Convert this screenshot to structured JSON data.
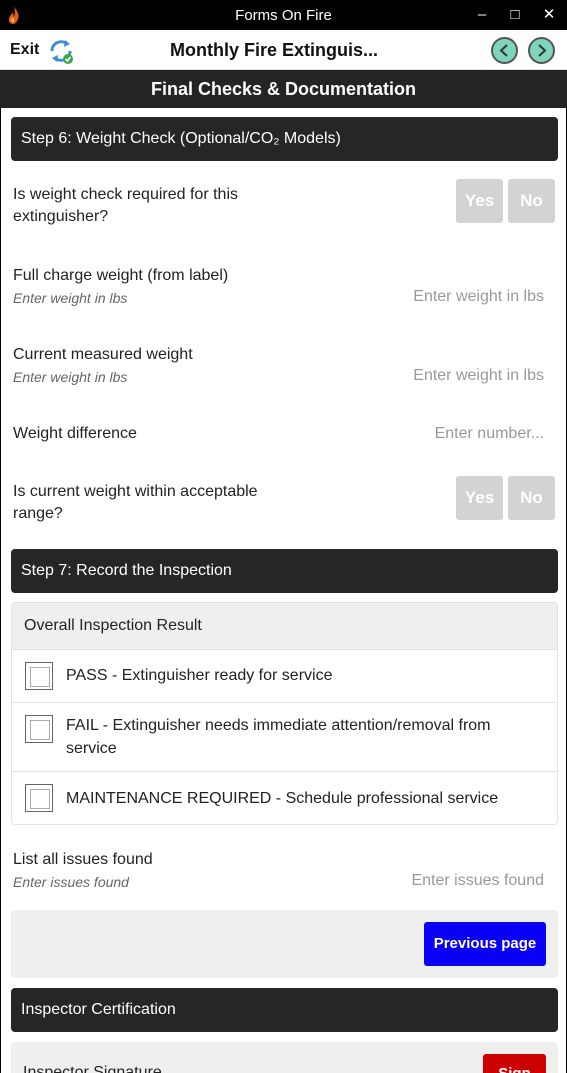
{
  "window": {
    "title": "Forms On Fire",
    "minimize_glyph": "‒",
    "maximize_glyph": "□",
    "close_glyph": "✕"
  },
  "toolbar": {
    "exit_label": "Exit",
    "form_title": "Monthly Fire Extinguis..."
  },
  "page": {
    "title": "Final Checks & Documentation"
  },
  "step6": {
    "heading": "Step 6: Weight Check (Optional/CO₂ Models)",
    "q_weight_required": {
      "label_line1": "Is weight check required for this",
      "label_line2": "extinguisher?",
      "yes": "Yes",
      "no": "No"
    },
    "full_charge": {
      "label": "Full charge weight (from label)",
      "hint": "Enter weight in lbs",
      "placeholder": "Enter weight in lbs"
    },
    "current_weight": {
      "label": "Current measured weight",
      "hint": "Enter weight in lbs",
      "placeholder": "Enter weight in lbs"
    },
    "difference": {
      "label": "Weight difference",
      "placeholder": "Enter number..."
    },
    "q_within_range": {
      "label_line1": "Is current weight within acceptable",
      "label_line2": "range?",
      "yes": "Yes",
      "no": "No"
    }
  },
  "step7": {
    "heading": "Step 7: Record the Inspection",
    "result": {
      "heading": "Overall Inspection Result",
      "options": [
        {
          "line1": "PASS - Extinguisher ready for service",
          "line2": ""
        },
        {
          "line1": "FAIL - Extinguisher needs immediate attention/removal from",
          "line2": "service"
        },
        {
          "line1": "MAINTENANCE REQUIRED - Schedule professional service",
          "line2": ""
        }
      ]
    },
    "issues": {
      "label": "List all issues found",
      "hint": "Enter issues found",
      "placeholder": "Enter issues found"
    }
  },
  "navigation": {
    "previous_label": "Previous page"
  },
  "certification": {
    "heading": "Inspector Certification",
    "signature_label": "Inspector Signature",
    "sign_label": "Sign"
  },
  "colors": {
    "accent_blue": "#0a00f5",
    "sign_red": "#cc0000",
    "section_dark": "#262626",
    "nav_green": "#7fd4bd"
  }
}
